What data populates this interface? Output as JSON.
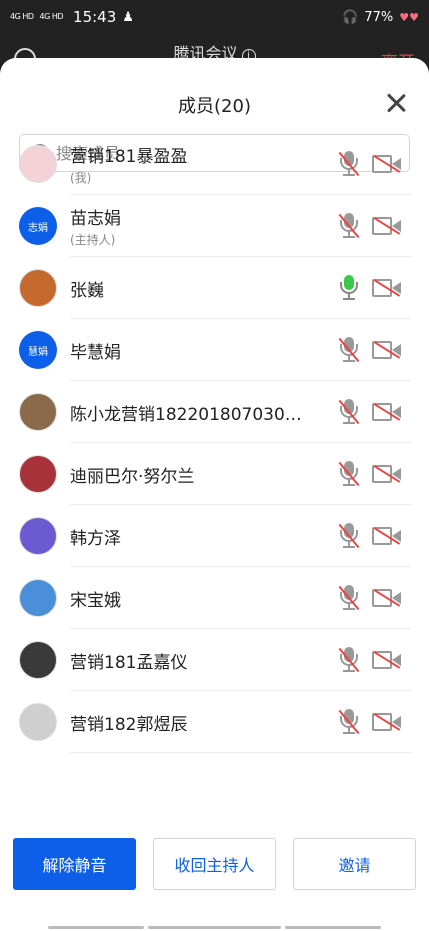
{
  "status_bar": {
    "signal1": "4G HD",
    "signal2": "4G HD",
    "time": "15:43",
    "battery": "77%"
  },
  "meeting": {
    "title": "腾讯会议",
    "leave_label": "离开"
  },
  "panel": {
    "title": "成员(20)",
    "search_placeholder": "搜索成员"
  },
  "members": [
    {
      "name": "营销181暴盈盈",
      "sub": "(我)",
      "avatar_type": "photo",
      "avatar_color": "#f3d3d8",
      "mic": "muted",
      "camera": "off"
    },
    {
      "name": "苗志娟",
      "sub": "(主持人)",
      "avatar_type": "initials",
      "initials": "志娟",
      "mic": "muted",
      "camera": "off"
    },
    {
      "name": "张巍",
      "sub": "",
      "avatar_type": "photo",
      "avatar_color": "#c46a2f",
      "mic": "on",
      "camera": "off"
    },
    {
      "name": "毕慧娟",
      "sub": "",
      "avatar_type": "initials",
      "initials": "慧娟",
      "mic": "muted",
      "camera": "off"
    },
    {
      "name": "陈小龙营销182201807030…",
      "sub": "",
      "avatar_type": "photo",
      "avatar_color": "#8a6a4a",
      "mic": "muted",
      "camera": "off"
    },
    {
      "name": "迪丽巴尔·努尔兰",
      "sub": "",
      "avatar_type": "photo",
      "avatar_color": "#a8323a",
      "mic": "muted",
      "camera": "off"
    },
    {
      "name": "韩方泽",
      "sub": "",
      "avatar_type": "photo",
      "avatar_color": "#6b5ad0",
      "mic": "muted",
      "camera": "off"
    },
    {
      "name": "宋宝娥",
      "sub": "",
      "avatar_type": "photo",
      "avatar_color": "#4a8fd8",
      "mic": "muted",
      "camera": "off"
    },
    {
      "name": "营销181孟嘉仪",
      "sub": "",
      "avatar_type": "photo",
      "avatar_color": "#3a3a3a",
      "mic": "muted",
      "camera": "off"
    },
    {
      "name": "营销182郭煜辰",
      "sub": "",
      "avatar_type": "photo",
      "avatar_color": "#cfcfcf",
      "mic": "muted",
      "camera": "off"
    }
  ],
  "actions": {
    "unmute": "解除静音",
    "reclaim_host": "收回主持人",
    "invite": "邀请"
  },
  "colors": {
    "accent": "#0d5fe8",
    "muted_red": "#e54545",
    "mic_on_green": "#3cc94a"
  }
}
